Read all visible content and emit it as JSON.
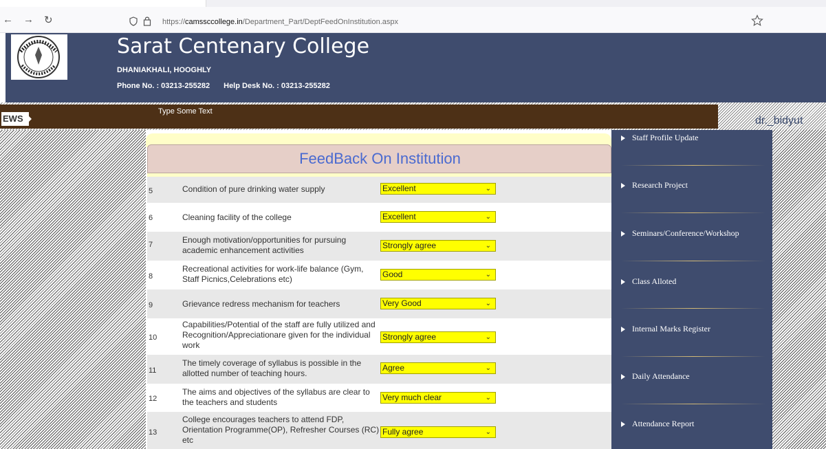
{
  "browser": {
    "url_prefix": "https://",
    "url_domain": "camssccollege.in",
    "url_path": "/Department_Part/DeptFeedOnInstitution.aspx"
  },
  "header": {
    "college_name": "Sarat Centenary College",
    "place": "DHANIAKHALI, HOOGHLY",
    "phone": "Phone No. : 03213-255282",
    "helpdesk": "Help Desk No. : 03213-255282"
  },
  "news": {
    "label": "EWS",
    "text": "Type Some Text"
  },
  "user": {
    "name": "dr._bidyut"
  },
  "form": {
    "title": "FeedBack On Institution",
    "rows": [
      {
        "num": "5",
        "question": "Condition of pure drinking water supply",
        "answer": "Excellent"
      },
      {
        "num": "6",
        "question": "Cleaning facility of the college",
        "answer": "Excellent"
      },
      {
        "num": "7",
        "question": "Enough motivation/opportunities for pursuing academic enhancement activities",
        "answer": "Strongly agree"
      },
      {
        "num": "8",
        "question": "Recreational activities for work-life balance (Gym, Staff Picnics,Celebrations etc)",
        "answer": "Good"
      },
      {
        "num": "9",
        "question": "Grievance redress mechanism for teachers",
        "answer": "Very Good"
      },
      {
        "num": "10",
        "question": "Capabilities/Potential of the staff are fully utilized and Recognition/Appreciationare given for the individual work",
        "answer": "Strongly agree"
      },
      {
        "num": "11",
        "question": "The timely coverage of syllabus is possible in the allotted number of teaching hours.",
        "answer": "Agree"
      },
      {
        "num": "12",
        "question": "The aims and objectives of the syllabus are clear to the teachers and students",
        "answer": "Very much clear"
      },
      {
        "num": "13",
        "question": "College encourages teachers to attend FDP, Orientation Programme(OP), Refresher Courses (RC) etc",
        "answer": "Fully agree"
      }
    ]
  },
  "sidebar": {
    "items": [
      {
        "label": "Staff Profile Update"
      },
      {
        "label": "Research Project"
      },
      {
        "label": "Seminars/Conference/Workshop"
      },
      {
        "label": "Class Alloted"
      },
      {
        "label": "Internal Marks Register"
      },
      {
        "label": "Daily Attendance"
      },
      {
        "label": "Attendance Report"
      }
    ]
  },
  "colors": {
    "header_bg": "#3f4c6e",
    "news_bg": "#4d3016",
    "select_bg": "#ffff00",
    "title_color": "#4a6ad0"
  }
}
